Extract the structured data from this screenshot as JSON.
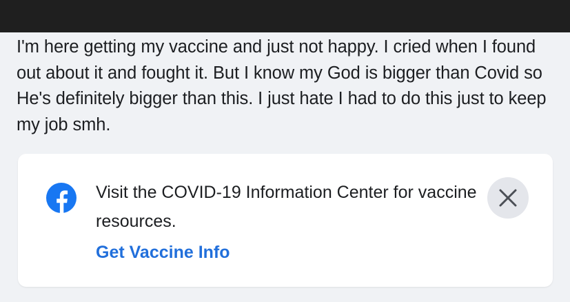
{
  "post": {
    "text": "I'm here getting my vaccine and just not happy. I cried when I found out about it and fought it. But I know my God is bigger than Covid so He's definitely bigger than this. I just hate I had to do this just to keep my job smh."
  },
  "info_card": {
    "icon": "facebook-logo-icon",
    "message": "Visit the COVID-19 Information Center for vaccine resources.",
    "link_label": "Get Vaccine Info",
    "close_icon": "close-icon"
  },
  "colors": {
    "top_bar": "#1f1f1f",
    "background": "#f0f2f5",
    "card": "#ffffff",
    "link": "#216fdb",
    "facebook_blue": "#1877f2",
    "close_button_bg": "#e4e6eb"
  }
}
